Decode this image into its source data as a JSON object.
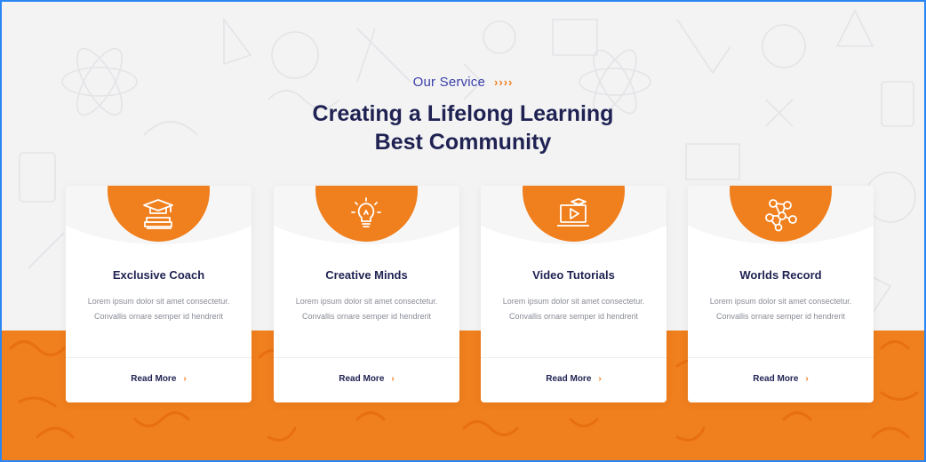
{
  "section": {
    "eyebrow": "Our Service",
    "eyebrow_arrows": "››››",
    "heading_line1": "Creating a Lifelong Learning",
    "heading_line2": "Best Community"
  },
  "colors": {
    "accent": "#f07f1d",
    "heading": "#1f2252",
    "eyebrow": "#3a3fa8",
    "body_text": "#8a8c96"
  },
  "cards": [
    {
      "icon": "graduation-cap-books-icon",
      "title": "Exclusive Coach",
      "text": "Lorem ipsum dolor sit amet consectetur. Convallis ornare semper id hendrerit",
      "link": "Read More",
      "chevron": "›"
    },
    {
      "icon": "lightbulb-icon",
      "title": "Creative Minds",
      "text": "Lorem ipsum dolor sit amet consectetur. Convallis ornare semper id hendrerit",
      "link": "Read More",
      "chevron": "›"
    },
    {
      "icon": "video-laptop-icon",
      "title": "Video Tutorials",
      "text": "Lorem ipsum dolor sit amet consectetur. Convallis ornare semper id hendrerit",
      "link": "Read More",
      "chevron": "›"
    },
    {
      "icon": "network-nodes-icon",
      "title": "Worlds Record",
      "text": "Lorem ipsum dolor sit amet consectetur. Convallis ornare semper id hendrerit",
      "link": "Read More",
      "chevron": "›"
    }
  ]
}
